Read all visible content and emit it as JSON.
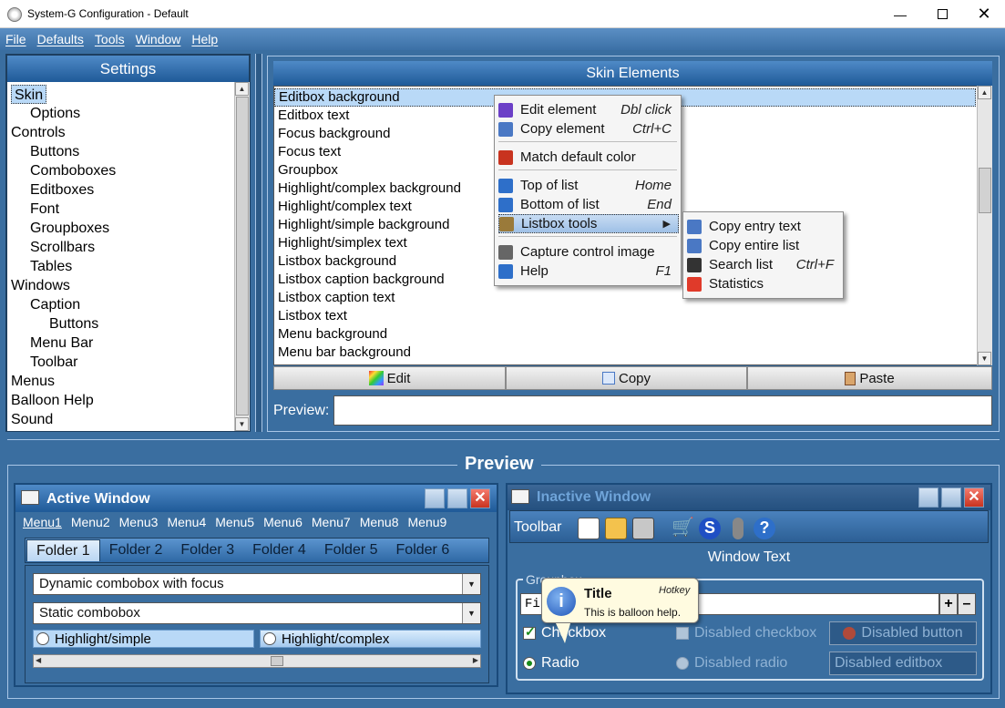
{
  "window": {
    "title": "System-G Configuration - Default"
  },
  "menubar": [
    "File",
    "Defaults",
    "Tools",
    "Window",
    "Help"
  ],
  "settings": {
    "header": "Settings",
    "items": [
      {
        "label": "Skin",
        "indent": 0,
        "selected": true
      },
      {
        "label": "Options",
        "indent": 1
      },
      {
        "label": "Controls",
        "indent": 0
      },
      {
        "label": "Buttons",
        "indent": 1
      },
      {
        "label": "Comboboxes",
        "indent": 1
      },
      {
        "label": "Editboxes",
        "indent": 1
      },
      {
        "label": "Font",
        "indent": 1
      },
      {
        "label": "Groupboxes",
        "indent": 1
      },
      {
        "label": "Scrollbars",
        "indent": 1
      },
      {
        "label": "Tables",
        "indent": 1
      },
      {
        "label": "Windows",
        "indent": 0
      },
      {
        "label": "Caption",
        "indent": 1
      },
      {
        "label": "Buttons",
        "indent": 2
      },
      {
        "label": "Menu Bar",
        "indent": 1
      },
      {
        "label": "Toolbar",
        "indent": 1
      },
      {
        "label": "Menus",
        "indent": 0
      },
      {
        "label": "Balloon Help",
        "indent": 0
      },
      {
        "label": "Sound",
        "indent": 0
      }
    ]
  },
  "skin_elements": {
    "header": "Skin Elements",
    "items": [
      "Editbox background",
      "Editbox text",
      "Focus background",
      "Focus text",
      "Groupbox",
      "Highlight/complex background",
      "Highlight/complex text",
      "Highlight/simple background",
      "Highlight/simplex text",
      "Listbox background",
      "Listbox caption background",
      "Listbox caption text",
      "Listbox text",
      "Menu background",
      "Menu bar background"
    ],
    "buttons": {
      "edit": "Edit",
      "copy": "Copy",
      "paste": "Paste"
    },
    "preview_label": "Preview:"
  },
  "context_menu": {
    "items": [
      {
        "label": "Edit element",
        "hotkey": "Dbl click",
        "icon": "palette-icon",
        "color": "#6b3fc7"
      },
      {
        "label": "Copy element",
        "hotkey": "Ctrl+C",
        "icon": "copy-icon",
        "color": "#4a78c4"
      },
      {
        "label": "Match default color",
        "hotkey": "",
        "icon": "match-color-icon",
        "color": "#c8331f"
      },
      {
        "label": "Top of list",
        "hotkey": "Home",
        "icon": "top-arrow-icon",
        "color": "#2e6fc9"
      },
      {
        "label": "Bottom of list",
        "hotkey": "End",
        "icon": "bottom-arrow-icon",
        "color": "#2e6fc9"
      },
      {
        "label": "Listbox tools",
        "hotkey": "",
        "icon": "tools-icon",
        "color": "#9a7a3a"
      },
      {
        "label": "Capture control image",
        "hotkey": "",
        "icon": "camera-icon",
        "color": "#666666"
      },
      {
        "label": "Help",
        "hotkey": "F1",
        "icon": "help-icon",
        "color": "#2e6fc9"
      }
    ]
  },
  "submenu": {
    "items": [
      {
        "label": "Copy entry text",
        "hotkey": "",
        "icon": "copy-entry-icon",
        "color": "#4a78c4"
      },
      {
        "label": "Copy entire list",
        "hotkey": "",
        "icon": "copy-list-icon",
        "color": "#4a78c4"
      },
      {
        "label": "Search list",
        "hotkey": "Ctrl+F",
        "icon": "binoculars-icon",
        "color": "#333333"
      },
      {
        "label": "Statistics",
        "hotkey": "",
        "icon": "pie-chart-icon",
        "color": "#e03a2a"
      }
    ]
  },
  "preview": {
    "header": "Preview",
    "active_window": {
      "title": "Active Window",
      "menus": [
        "Menu1",
        "Menu2",
        "Menu3",
        "Menu4",
        "Menu5",
        "Menu6",
        "Menu7",
        "Menu8",
        "Menu9"
      ],
      "tabs": [
        "Folder 1",
        "Folder 2",
        "Folder 3",
        "Folder 4",
        "Folder 5",
        "Folder 6"
      ],
      "combo_focus": "Dynamic combobox with focus",
      "combo_static": "Static combobox",
      "highlight_simple": "Highlight/simple",
      "highlight_complex": "Highlight/complex"
    },
    "inactive_window": {
      "title": "Inactive Window",
      "toolbar_label": "Toolbar",
      "window_text": "Window Text",
      "groupbox_label": "Groupbox",
      "editbox_value": "Fi",
      "checkbox": "Checkbox",
      "disabled_checkbox": "Disabled checkbox",
      "disabled_button": "Disabled button",
      "radio": "Radio",
      "disabled_radio": "Disabled radio",
      "disabled_editbox": "Disabled editbox"
    },
    "balloon": {
      "title": "Title",
      "hotkey": "Hotkey",
      "text": "This is balloon help."
    }
  },
  "colors": {
    "background": "#3a6ea0",
    "header": "#1f5a98",
    "selection": "#b9d9f7"
  }
}
